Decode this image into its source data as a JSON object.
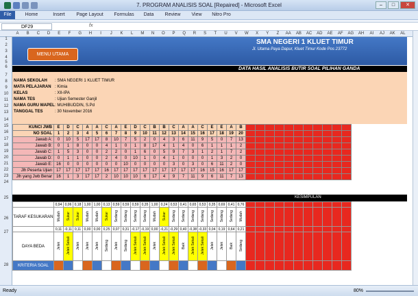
{
  "window": {
    "title": "7. PROGRAM ANALISIS SOAL [Repaired] - Microsoft Excel"
  },
  "ribbon": {
    "tabs": [
      "File",
      "Home",
      "Insert",
      "Page Layout",
      "Formulas",
      "Data",
      "Review",
      "View",
      "Nitro Pro"
    ]
  },
  "formula": {
    "cell": "DF29",
    "fx": "fx",
    "value": ""
  },
  "columns": [
    "A",
    "B",
    "C",
    "D",
    "E",
    "F",
    "G",
    "H",
    "I",
    "J",
    "K",
    "L",
    "M",
    "N",
    "O",
    "P",
    "Q",
    "R",
    "S",
    "T",
    "U",
    "V",
    "W",
    "X",
    "Y",
    "Z",
    "AA",
    "AB",
    "AC",
    "AD",
    "AE",
    "AF",
    "AG",
    "AH",
    "AI",
    "AJ",
    "AK",
    "AL"
  ],
  "rows": [
    "1",
    "2",
    "3",
    "4",
    "5",
    "6",
    "7",
    "8",
    "9",
    "10",
    "11",
    "12",
    "13",
    "14",
    "15",
    "16",
    "17",
    "18",
    "19",
    "20",
    "21",
    "22",
    "23",
    "24",
    "25",
    "26",
    "27",
    "28"
  ],
  "header": {
    "school": "SMA NEGERI 1 KLUET TIMUR",
    "address": "Jl. Utama Paya Dapur, Kluet Timur Kode Pos 23772",
    "menu_button": "MENU UTAMA",
    "report_title": "DATA HASIL ANALISIS BUTIR SOAL PILIHAN GANDA"
  },
  "info": [
    {
      "label": "NAMA SEKOLAH",
      "value": ": SMA NEGERI 1 KLUET TIMUR"
    },
    {
      "label": "MATA PELAJARAN",
      "value": ": Kimia"
    },
    {
      "label": "KELAS",
      "value": ": XII-IPA"
    },
    {
      "label": "NAMA TES",
      "value": ": Ujian Semester Ganjil"
    },
    {
      "label": "NAMA GURU MAPEL",
      "value": ": MUHIBUDDIN, S.Pd"
    },
    {
      "label": "TANGGAL TES",
      "value": ": 30  November 2016"
    }
  ],
  "table": {
    "kunci_label": "KUNCI JWB",
    "no_label": "NO SOAL",
    "kunci": [
      "E",
      "D",
      "C",
      "A",
      "A",
      "C",
      "A",
      "E",
      "D",
      "C",
      "B",
      "B",
      "C",
      "A",
      "A",
      "C",
      "E",
      "E",
      "A",
      "B"
    ],
    "nomor": [
      "1",
      "2",
      "3",
      "4",
      "5",
      "6",
      "7",
      "8",
      "9",
      "10",
      "11",
      "12",
      "13",
      "14",
      "15",
      "16",
      "17",
      "18",
      "19",
      "20"
    ],
    "rows": [
      {
        "label": "Jawab A:",
        "values": [
          "0",
          "10",
          "5",
          "17",
          "17",
          "8",
          "10",
          "7",
          "5",
          "2",
          "0",
          "4",
          "3",
          "6",
          "11",
          "9",
          "5",
          "0",
          "7",
          "13"
        ]
      },
      {
        "label": "Jawab B:",
        "values": [
          "0",
          "1",
          "8",
          "0",
          "0",
          "4",
          "1",
          "0",
          "1",
          "8",
          "17",
          "4",
          "1",
          "4",
          "0",
          "6",
          "1",
          "1",
          "1",
          "2"
        ]
      },
      {
        "label": "Jawab C:",
        "values": [
          "1",
          "5",
          "3",
          "0",
          "0",
          "2",
          "2",
          "0",
          "1",
          "6",
          "0",
          "5",
          "9",
          "7",
          "3",
          "1",
          "2",
          "1",
          "7",
          "2"
        ]
      },
      {
        "label": "Jawab D:",
        "values": [
          "0",
          "1",
          "1",
          "0",
          "0",
          "2",
          "4",
          "0",
          "10",
          "1",
          "0",
          "4",
          "1",
          "0",
          "0",
          "0",
          "1",
          "3",
          "2",
          "0"
        ]
      },
      {
        "label": "Jawab E:",
        "values": [
          "16",
          "0",
          "0",
          "0",
          "0",
          "0",
          "0",
          "10",
          "0",
          "0",
          "0",
          "0",
          "3",
          "0",
          "3",
          "0",
          "6",
          "11",
          "2",
          "0"
        ]
      },
      {
        "label": "Jlh Peserta Ujian",
        "values": [
          "17",
          "17",
          "17",
          "17",
          "17",
          "16",
          "17",
          "17",
          "17",
          "17",
          "17",
          "17",
          "17",
          "17",
          "17",
          "16",
          "15",
          "16",
          "17",
          "17"
        ]
      },
      {
        "label": "Jlh yang Jwb Benar",
        "values": [
          "16",
          "1",
          "3",
          "17",
          "17",
          "2",
          "10",
          "10",
          "10",
          "6",
          "17",
          "4",
          "9",
          "7",
          "11",
          "9",
          "6",
          "11",
          "7",
          "13"
        ]
      }
    ]
  },
  "kesimpulan": "KESIMPULAN",
  "taraf": {
    "label": "TARAF KESUKARAN",
    "values": [
      "0,94",
      "0,06",
      "0,18",
      "1,00",
      "1,00",
      "0,13",
      "0,59",
      "0,59",
      "0,59",
      "0,35",
      "1,00",
      "0,24",
      "0,53",
      "0,41",
      "0,65",
      "0,53",
      "0,35",
      "0,69",
      "0,41",
      "0,76"
    ],
    "kategori": [
      "Mudah",
      "Sukar",
      "Sukar",
      "Mudah",
      "Mudah",
      "Sukar",
      "Sedang",
      "Sedang",
      "Sedang",
      "Sedang",
      "Mudah",
      "Sukar",
      "Sedang",
      "Sedang",
      "Sedang",
      "Sedang",
      "Sedang",
      "Sedang",
      "Sedang",
      "Mudah"
    ]
  },
  "daya_beda": {
    "label": "DAYA BEDA",
    "values": [
      "0,11",
      "-0,11",
      "0,11",
      "0,00",
      "0,00",
      "0,25",
      "0,07",
      "0,31",
      "-0,17",
      "-0,19",
      "0,00",
      "-0,21",
      "-0,29",
      "0,40",
      "-0,38",
      "-0,33",
      "0,04",
      "0,19",
      "0,64",
      "0,21"
    ],
    "kategori": [
      "Jelek",
      "Jelek Sekali",
      "Jelek",
      "Jelek",
      "Jelek",
      "Sedang",
      "Jelek",
      "Sedang",
      "Jelek Sekali",
      "Jelek Sekali",
      "Jelek",
      "Jelek Sekali",
      "Jelek Sekali",
      "Baik",
      "Jelek Sekali",
      "Jelek Sekali",
      "Jelek",
      "Jelek",
      "Baik",
      "Sedang"
    ]
  },
  "kriteria_label": "KRITERIA SOAL",
  "status": {
    "ready": "Ready",
    "zoom": "80%"
  }
}
